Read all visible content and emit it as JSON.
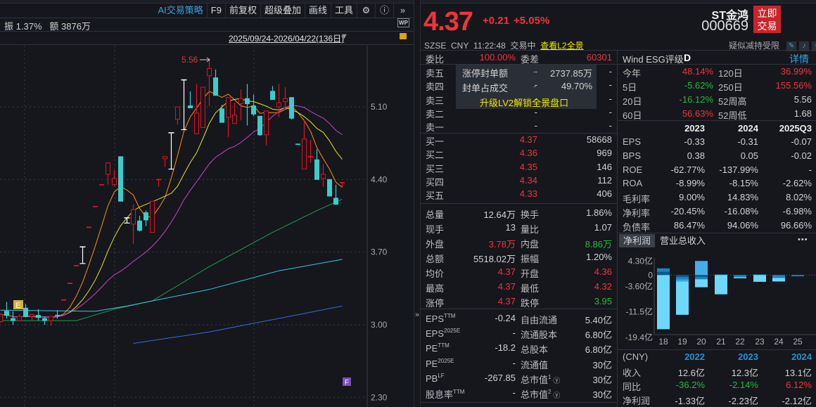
{
  "toolbar": {
    "items": [
      "AI交易策略",
      "F9",
      "前复权",
      "超级叠加",
      "画线",
      "工具"
    ],
    "icons": [
      "gear-icon",
      "help-icon",
      "expand-icon"
    ]
  },
  "info": {
    "amplitude_label": "振",
    "amplitude": "1.37%",
    "amount_label": "额",
    "amount": "3876万",
    "wp": "WP"
  },
  "range": "2025/09/24-2026/04/22(136日)",
  "chart_data": {
    "type": "candlestick",
    "yticks": [
      5.1,
      4.4,
      3.7,
      3.0,
      2.3
    ],
    "ytick_labels": [
      "5.10",
      "4.40",
      "3.70",
      "3.00",
      "2.30"
    ],
    "ylim": [
      2.3,
      5.56
    ],
    "high_label": "5.56",
    "markers": [
      "E",
      "F"
    ],
    "candles": [
      [
        3.03,
        3.11,
        3.02,
        3.1,
        "u"
      ],
      [
        3.13,
        3.22,
        3.06,
        3.09,
        "d"
      ],
      [
        3.06,
        3.13,
        3.0,
        3.04,
        "d"
      ],
      [
        3.04,
        3.1,
        3.03,
        3.08,
        "u"
      ],
      [
        3.16,
        3.2,
        3.07,
        3.08,
        "d"
      ],
      [
        3.08,
        3.1,
        3.04,
        3.1,
        "u"
      ],
      [
        3.09,
        3.15,
        3.04,
        3.07,
        "d"
      ],
      [
        3.06,
        3.08,
        3.0,
        3.04,
        "d"
      ],
      [
        3.04,
        3.08,
        2.99,
        3.08,
        "u"
      ],
      [
        3.09,
        3.14,
        3.06,
        3.09,
        "d"
      ],
      [
        3.24,
        3.24,
        3.24,
        3.24,
        "u"
      ],
      [
        3.4,
        3.4,
        3.4,
        3.4,
        "u"
      ],
      [
        3.57,
        3.57,
        3.57,
        3.57,
        "u"
      ],
      [
        3.75,
        3.75,
        3.59,
        3.75,
        "w"
      ],
      [
        3.94,
        3.94,
        3.94,
        3.94,
        "u"
      ],
      [
        4.14,
        4.14,
        4.14,
        4.14,
        "u"
      ],
      [
        4.35,
        4.35,
        4.35,
        4.35,
        "u"
      ],
      [
        4.45,
        4.56,
        4.35,
        4.56,
        "u"
      ],
      [
        4.35,
        4.49,
        4.33,
        4.41,
        "u"
      ],
      [
        4.62,
        4.62,
        4.19,
        4.19,
        "d"
      ],
      [
        4.03,
        4.03,
        3.98,
        3.98,
        "w"
      ],
      [
        3.97,
        4.16,
        3.78,
        4.11,
        "u"
      ],
      [
        4.0,
        4.05,
        3.9,
        3.91,
        "d"
      ],
      [
        4.08,
        4.1,
        3.95,
        4.01,
        "d"
      ],
      [
        3.89,
        4.19,
        3.89,
        4.19,
        "u"
      ],
      [
        4.4,
        4.4,
        4.33,
        4.4,
        "u"
      ],
      [
        4.6,
        4.62,
        4.52,
        4.62,
        "u"
      ],
      [
        4.85,
        4.85,
        4.5,
        4.85,
        "w"
      ],
      [
        4.98,
        5.1,
        4.93,
        5.1,
        "u"
      ],
      [
        5.36,
        5.36,
        4.88,
        5.36,
        "w"
      ],
      [
        5.11,
        5.25,
        5.09,
        5.09,
        "d"
      ],
      [
        4.84,
        5.32,
        4.84,
        5.04,
        "u"
      ],
      [
        4.9,
        5.29,
        4.9,
        5.29,
        "u"
      ],
      [
        5.4,
        5.56,
        5.11,
        5.47,
        "u"
      ],
      [
        5.38,
        5.46,
        5.21,
        5.21,
        "d"
      ],
      [
        5.08,
        5.12,
        4.95,
        4.95,
        "d"
      ],
      [
        5.0,
        5.19,
        4.81,
        5.19,
        "u"
      ],
      [
        4.94,
        5.14,
        4.94,
        5.02,
        "u"
      ],
      [
        5.13,
        5.27,
        4.97,
        5.18,
        "u"
      ],
      [
        5.18,
        5.32,
        4.92,
        5.13,
        "d"
      ],
      [
        5.11,
        5.22,
        5.01,
        5.03,
        "d"
      ],
      [
        5.01,
        5.01,
        4.82,
        4.83,
        "d"
      ],
      [
        4.83,
        5.06,
        4.73,
        5.06,
        "u"
      ],
      [
        5.25,
        5.3,
        5.17,
        5.17,
        "d"
      ],
      [
        5.1,
        5.32,
        5.0,
        5.14,
        "u"
      ],
      [
        5.15,
        5.29,
        5.09,
        5.18,
        "u"
      ],
      [
        5.19,
        5.19,
        4.98,
        4.99,
        "d"
      ],
      [
        4.74,
        4.74,
        4.74,
        4.74,
        "d"
      ],
      [
        4.5,
        4.97,
        4.5,
        4.79,
        "u"
      ],
      [
        4.62,
        4.78,
        4.56,
        4.62,
        "u"
      ],
      [
        4.59,
        4.69,
        4.4,
        4.4,
        "d"
      ],
      [
        4.41,
        4.55,
        4.33,
        4.45,
        "u"
      ],
      [
        4.4,
        4.4,
        4.24,
        4.24,
        "d"
      ],
      [
        4.22,
        4.35,
        4.16,
        4.16,
        "d"
      ],
      [
        4.36,
        4.37,
        4.32,
        4.37,
        "u"
      ]
    ],
    "ma_computed": [
      {
        "period": 5,
        "color": "#ff8c1a"
      },
      {
        "period": 10,
        "color": "#e8e030"
      },
      {
        "period": 20,
        "color": "#d040d0"
      }
    ],
    "ma_points": [
      {
        "name": "ma60",
        "color": "#1fa04a",
        "points": [
          [
            0,
            3.04
          ],
          [
            12,
            3.04
          ],
          [
            18,
            3.15
          ],
          [
            24,
            3.23
          ],
          [
            33,
            3.56
          ],
          [
            43,
            3.89
          ],
          [
            50,
            4.1
          ],
          [
            54,
            4.21
          ]
        ]
      },
      {
        "name": "ma120",
        "color": "#3cc8e0",
        "points": [
          [
            0,
            3.14
          ],
          [
            15,
            3.13
          ],
          [
            20,
            3.18
          ],
          [
            33,
            3.34
          ],
          [
            44,
            3.52
          ],
          [
            54,
            3.63
          ]
        ]
      },
      {
        "name": "ma250",
        "color": "#3a6ae0",
        "points": [
          [
            21,
            2.82
          ],
          [
            33,
            2.93
          ],
          [
            54,
            3.18
          ]
        ]
      }
    ]
  },
  "quote": {
    "price": "4.37",
    "change": "+0.21",
    "pct": "+5.05%",
    "name": "ST金鸿",
    "code": "000669",
    "trade_btn": [
      "立即",
      "交易"
    ],
    "exchange": "SZSE",
    "currency": "CNY",
    "time": "11:22:48",
    "status": "交易中",
    "l2_link": "查看L2全景",
    "warning": "疑似减持受限"
  },
  "committee": {
    "ratio_label": "委比",
    "ratio": "100.00%",
    "diff_label": "委差",
    "diff": "60301"
  },
  "orderbook": {
    "asks": [
      {
        "label": "卖五",
        "price": "-",
        "vol": "-"
      },
      {
        "label": "卖四",
        "price": "-",
        "vol": "-"
      },
      {
        "label": "卖三",
        "price": "-",
        "vol": "-"
      },
      {
        "label": "卖二",
        "price": "-",
        "vol": "-"
      },
      {
        "label": "卖一",
        "price": "-",
        "vol": "-"
      }
    ],
    "bids": [
      {
        "label": "买一",
        "price": "4.37",
        "vol": "58668"
      },
      {
        "label": "买二",
        "price": "4.36",
        "vol": "969"
      },
      {
        "label": "买三",
        "price": "4.35",
        "vol": "146"
      },
      {
        "label": "买四",
        "price": "4.34",
        "vol": "112"
      },
      {
        "label": "买五",
        "price": "4.33",
        "vol": "406"
      }
    ]
  },
  "overlay": {
    "rows": [
      {
        "label": "涨停封单额",
        "dash": "-",
        "value": "2737.85万"
      },
      {
        "label": "封单占成交",
        "dash": "-",
        "value": "49.70%"
      }
    ],
    "upgrade": "升级LV2解锁全景盘口"
  },
  "stats": [
    {
      "l1": "总量",
      "v1": "12.64万",
      "c1": "",
      "l2": "换手",
      "v2": "1.86%",
      "c2": ""
    },
    {
      "l1": "现手",
      "v1": "13",
      "c1": "",
      "l2": "量比",
      "v2": "1.07",
      "c2": ""
    },
    {
      "l1": "外盘",
      "v1": "3.78万",
      "c1": "red",
      "l2": "内盘",
      "v2": "8.86万",
      "c2": "green"
    },
    {
      "l1": "总额",
      "v1": "5518.02万",
      "c1": "",
      "l2": "振幅",
      "v2": "1.20%",
      "c2": ""
    },
    {
      "l1": "均价",
      "v1": "4.37",
      "c1": "red",
      "l2": "开盘",
      "v2": "4.36",
      "c2": "red"
    },
    {
      "l1": "最高",
      "v1": "4.37",
      "c1": "red",
      "l2": "最低",
      "v2": "4.32",
      "c2": "red"
    },
    {
      "l1": "涨停",
      "v1": "4.37",
      "c1": "red",
      "l2": "跌停",
      "v2": "3.95",
      "c2": "green"
    }
  ],
  "fundamentals": [
    {
      "l1": "EPS",
      "s1": "TTM",
      "v1": "-0.24",
      "l2": "自由流通",
      "s2": "",
      "v2": "5.40亿"
    },
    {
      "l1": "EPS",
      "s1": "2025E",
      "v1": "-",
      "l2": "流通股本",
      "s2": "",
      "v2": "6.80亿"
    },
    {
      "l1": "PE",
      "s1": "TTM",
      "v1": "-18.2",
      "l2": "总股本",
      "s2": "",
      "v2": "6.80亿"
    },
    {
      "l1": "PE",
      "s1": "2025E",
      "v1": "-",
      "l2": "流通值",
      "s2": "",
      "v2": "30亿"
    },
    {
      "l1": "PB",
      "s1": "LF",
      "v1": "-267.85",
      "l2": "总市值",
      "s2": "1",
      "v2": "30亿"
    },
    {
      "l1": "股息率",
      "s1": "TTM",
      "v1": "-",
      "l2": "总市值",
      "s2": "2",
      "v2": "30亿"
    }
  ],
  "esg": {
    "label": "Wind  ESG评级",
    "grade": "D",
    "detail": "详情"
  },
  "returns": [
    {
      "l1": "今年",
      "v1": "48.14%",
      "c1": "red",
      "l2": "120日",
      "v2": "36.99%",
      "c2": "red"
    },
    {
      "l1": "5日",
      "v1": "-5.62%",
      "c1": "green",
      "l2": "250日",
      "v2": "155.56%",
      "c2": "red"
    },
    {
      "l1": "20日",
      "v1": "-16.12%",
      "c1": "green",
      "l2": "52周高",
      "v2": "5.56",
      "c2": ""
    },
    {
      "l1": "60日",
      "v1": "56.63%",
      "c1": "red",
      "l2": "52周低",
      "v2": "1.68",
      "c2": ""
    }
  ],
  "financials": {
    "headers": [
      "2023",
      "2024",
      "2025Q3"
    ],
    "rows": [
      {
        "label": "EPS",
        "values": [
          "-0.33",
          "-0.31",
          "-0.07"
        ]
      },
      {
        "label": "BPS",
        "values": [
          "0.38",
          "0.05",
          "-0.02"
        ]
      },
      {
        "label": "ROE",
        "values": [
          "-62.77%",
          "-137.99%",
          "-"
        ]
      },
      {
        "label": "ROA",
        "values": [
          "-8.99%",
          "-8.15%",
          "-2.62%"
        ]
      },
      {
        "label": "毛利率",
        "values": [
          "9.00%",
          "14.83%",
          "8.02%"
        ]
      },
      {
        "label": "净利率",
        "values": [
          "-20.45%",
          "-16.08%",
          "-6.98%"
        ]
      },
      {
        "label": "负债率",
        "values": [
          "86.47%",
          "94.06%",
          "96.66%"
        ]
      }
    ]
  },
  "profit_tabs": [
    "净利润",
    "营业总收入"
  ],
  "more": "•••",
  "profit_chart": {
    "type": "bar",
    "ytick_values": [
      4.3,
      0,
      -3.6,
      -11.5,
      -19.4
    ],
    "ytick_labels": [
      "4.30亿",
      "0",
      "-3.60亿",
      "-11.5亿",
      "-19.4亿"
    ],
    "years": [
      "18",
      "19",
      "20",
      "21",
      "22",
      "23",
      "24",
      "25"
    ],
    "unit": "亿",
    "segments": [
      [
        [
          1.0,
          "#0b5a8e"
        ],
        [
          1.1,
          "#1a85c4"
        ],
        [
          -16.9,
          "#6ed8fa"
        ]
      ],
      [
        [
          -0.6,
          "#0b5a8e"
        ],
        [
          -0.7,
          "#1a85c4"
        ],
        [
          -0.7,
          "#3aa7e0"
        ],
        [
          -10.4,
          "#6ed8fa"
        ]
      ],
      [
        [
          4.4,
          "#44aee8"
        ],
        [
          -0.6,
          "#0b5a8e"
        ],
        [
          -0.7,
          "#1a85c4"
        ],
        [
          -2.5,
          "#6ed8fa"
        ]
      ],
      [
        [
          0.2,
          "#1a85c4"
        ],
        [
          -6.0,
          "#6ed8fa"
        ]
      ],
      [
        [
          -0.7,
          "#1a85c4"
        ],
        [
          -0.3,
          "#6ed8fa"
        ]
      ],
      [
        [
          0.2,
          "#1a85c4"
        ],
        [
          -2.1,
          "#6ed8fa"
        ]
      ],
      [
        [
          -0.9,
          "#1a85c4"
        ],
        [
          -1.1,
          "#6ed8fa"
        ]
      ],
      [
        [
          -0.4,
          "#1a85c4"
        ]
      ]
    ]
  },
  "annual": {
    "currency": "(CNY)",
    "years": [
      "2022",
      "2023",
      "2024"
    ],
    "rows": [
      {
        "label": "收入",
        "values": [
          "12.6亿",
          "12.3亿",
          "13.1亿"
        ],
        "tones": [
          "",
          "",
          ""
        ]
      },
      {
        "label": "同比",
        "values": [
          "-36.2%",
          "-2.14%",
          "6.12%"
        ],
        "tones": [
          "green",
          "green",
          "red"
        ]
      },
      {
        "label": "净利润",
        "values": [
          "-1.33亿",
          "-2.23亿",
          "-2.12亿"
        ],
        "tones": [
          "",
          "",
          ""
        ]
      }
    ]
  }
}
